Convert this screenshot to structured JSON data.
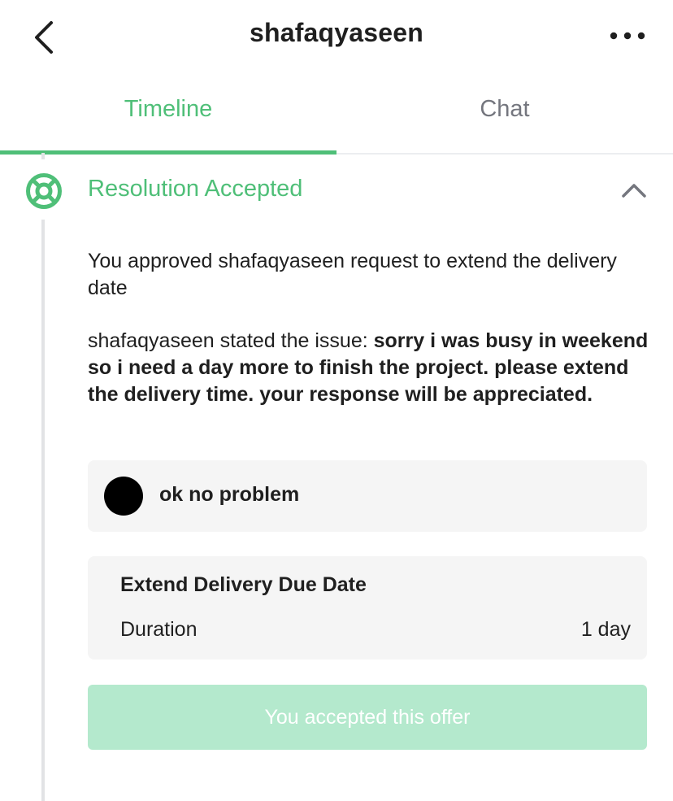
{
  "header": {
    "title": "shafaqyaseen",
    "back_icon": "chevron-left-icon",
    "more_icon": "more-horizontal-icon"
  },
  "tabs": [
    {
      "label": "Timeline",
      "active": true
    },
    {
      "label": "Chat",
      "active": false
    }
  ],
  "section": {
    "icon": "lifebuoy-icon",
    "title": "Resolution Accepted",
    "collapse_icon": "chevron-up-icon",
    "approved_text": "You approved shafaqyaseen request to extend the delivery date",
    "issue_prefix": "shafaqyaseen stated the issue: ",
    "issue_text": "sorry i was busy in weekend so i need a day more to finish the project. please extend the delivery time. your response will be appreciated."
  },
  "message": {
    "text": "ok no problem"
  },
  "extension": {
    "title": "Extend Delivery Due Date",
    "duration_label": "Duration",
    "duration_value": "1 day"
  },
  "status_button": {
    "label": "You accepted this offer"
  },
  "colors": {
    "accent": "#4fbf78",
    "accepted_button": "#b4e9cd",
    "card_background": "#f5f5f5",
    "inactive_tab": "#74767e"
  }
}
